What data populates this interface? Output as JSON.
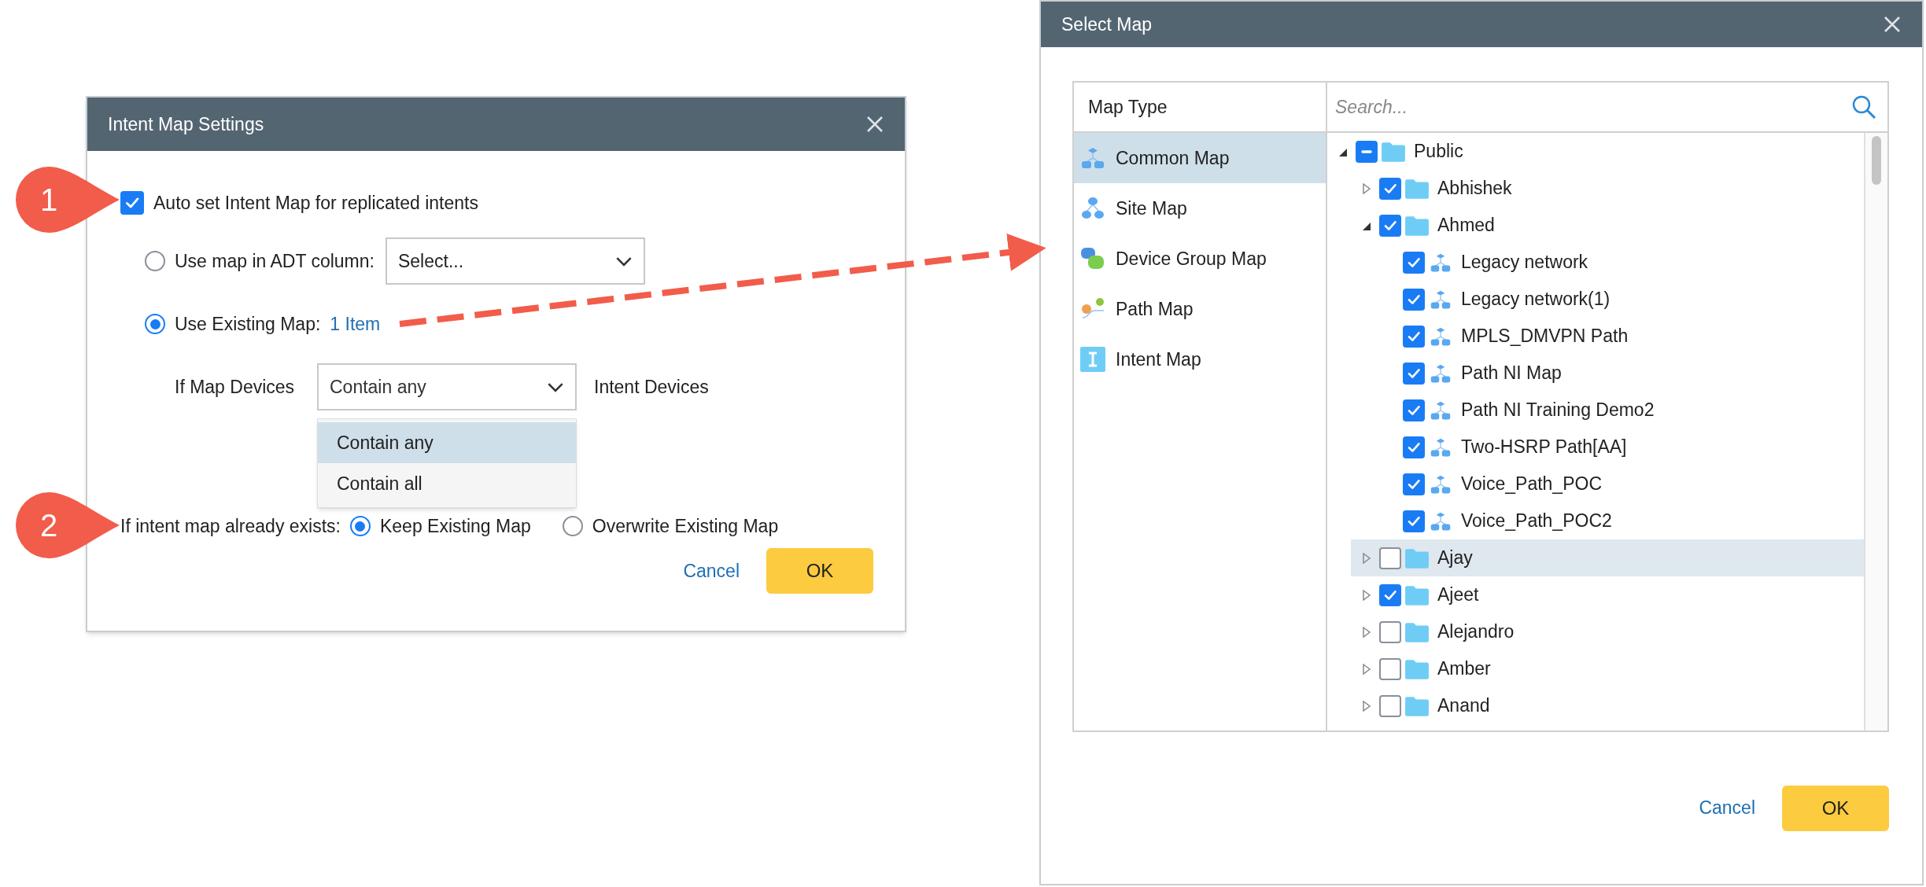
{
  "callouts": [
    {
      "label": "1"
    },
    {
      "label": "2"
    }
  ],
  "intent_dialog": {
    "title": "Intent Map Settings",
    "auto_set": {
      "label": "Auto set Intent Map for replicated intents",
      "checked": true
    },
    "map_source": [
      {
        "kind": "select",
        "label": "Use map in ADT column:",
        "selected": false,
        "value": "Select..."
      },
      {
        "kind": "link",
        "label": "Use Existing Map:",
        "selected": true,
        "link": "1 Item"
      }
    ],
    "device_match": {
      "label": "If Map Devices",
      "value": "Contain any",
      "suffix": "Intent Devices",
      "options": [
        {
          "label": "Contain any",
          "selected": true
        },
        {
          "label": "Contain all",
          "selected": false
        }
      ]
    },
    "existing": {
      "label": "If intent map already exists:",
      "options": [
        {
          "label": "Keep Existing Map",
          "selected": true
        },
        {
          "label": "Overwrite Existing Map",
          "selected": false
        }
      ]
    },
    "buttons": [
      {
        "kind": "link",
        "label": "Cancel"
      },
      {
        "kind": "primary",
        "label": "OK"
      }
    ]
  },
  "select_dialog": {
    "title": "Select Map",
    "map_type_header": "Map Type",
    "map_types": [
      {
        "kind": "common",
        "label": "Common Map",
        "selected": true
      },
      {
        "kind": "site",
        "label": "Site Map",
        "selected": false
      },
      {
        "kind": "device_group",
        "label": "Device Group Map",
        "selected": false
      },
      {
        "kind": "path",
        "label": "Path Map",
        "selected": false
      },
      {
        "kind": "intent",
        "label": "Intent Map",
        "selected": false
      }
    ],
    "search": {
      "placeholder": "Search..."
    },
    "tree": [
      {
        "kind": "folder",
        "label": "Public",
        "checked": false,
        "indeterminate": true,
        "expanded": true,
        "selected": false,
        "children": [
          {
            "kind": "folder",
            "label": "Abhishek",
            "checked": true,
            "indeterminate": false,
            "expanded": false,
            "selected": false
          },
          {
            "kind": "folder",
            "label": "Ahmed",
            "checked": true,
            "indeterminate": false,
            "expanded": true,
            "selected": false,
            "children": [
              {
                "kind": "map",
                "label": "Legacy network",
                "checked": true,
                "indeterminate": false,
                "selected": false
              },
              {
                "kind": "map",
                "label": "Legacy network(1)",
                "checked": true,
                "indeterminate": false,
                "selected": false
              },
              {
                "kind": "map",
                "label": "MPLS_DMVPN Path",
                "checked": true,
                "indeterminate": false,
                "selected": false
              },
              {
                "kind": "map",
                "label": "Path NI Map",
                "checked": true,
                "indeterminate": false,
                "selected": false
              },
              {
                "kind": "map",
                "label": "Path NI Training Demo2",
                "checked": true,
                "indeterminate": false,
                "selected": false
              },
              {
                "kind": "map",
                "label": "Two-HSRP Path[AA]",
                "checked": true,
                "indeterminate": false,
                "selected": false
              },
              {
                "kind": "map",
                "label": "Voice_Path_POC",
                "checked": true,
                "indeterminate": false,
                "selected": false
              },
              {
                "kind": "map",
                "label": "Voice_Path_POC2",
                "checked": true,
                "indeterminate": false,
                "selected": false
              }
            ]
          },
          {
            "kind": "folder",
            "label": "Ajay",
            "checked": false,
            "indeterminate": false,
            "expanded": false,
            "selected": true
          },
          {
            "kind": "folder",
            "label": "Ajeet",
            "checked": true,
            "indeterminate": false,
            "expanded": false,
            "selected": false
          },
          {
            "kind": "folder",
            "label": "Alejandro",
            "checked": false,
            "indeterminate": false,
            "expanded": false,
            "selected": false
          },
          {
            "kind": "folder",
            "label": "Amber",
            "checked": false,
            "indeterminate": false,
            "expanded": false,
            "selected": false
          },
          {
            "kind": "folder",
            "label": "Anand",
            "checked": false,
            "indeterminate": false,
            "expanded": false,
            "selected": false
          }
        ]
      }
    ],
    "buttons": [
      {
        "kind": "link",
        "label": "Cancel"
      },
      {
        "kind": "primary",
        "label": "OK"
      }
    ]
  }
}
